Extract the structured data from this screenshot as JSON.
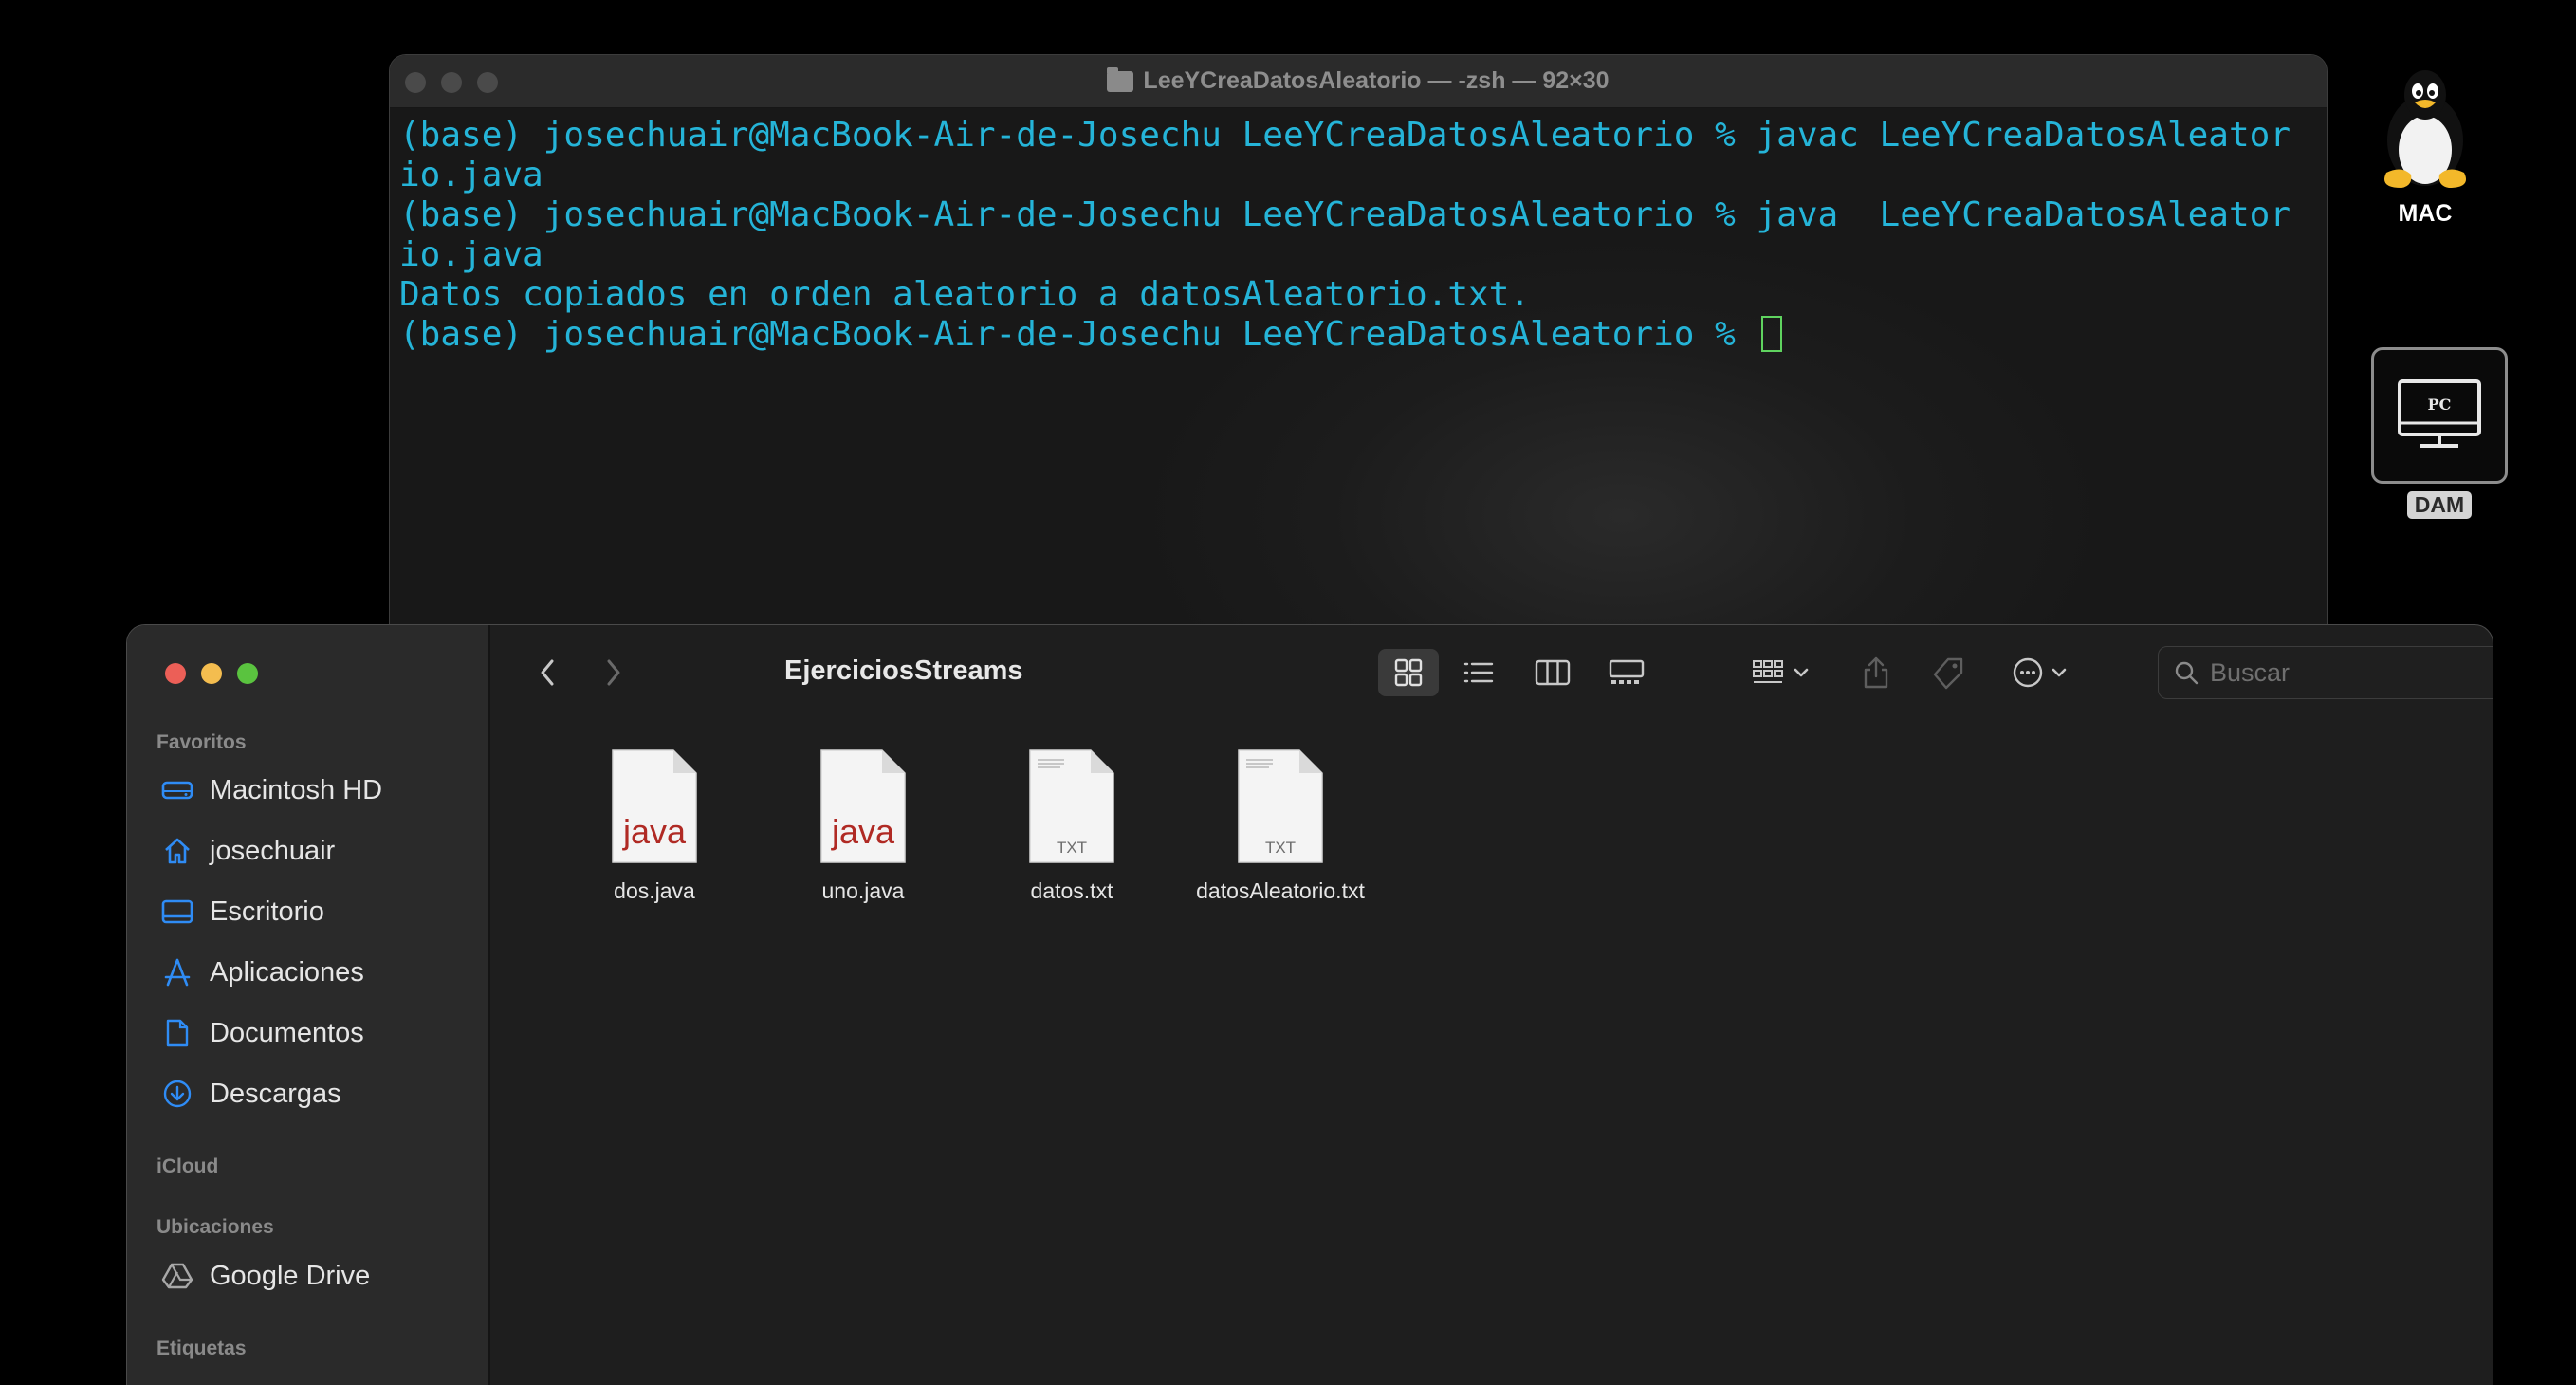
{
  "terminal": {
    "title": "LeeYCreaDatosAleatorio — -zsh — 92×30",
    "lines": [
      "(base) josechuair@MacBook-Air-de-Josechu LeeYCreaDatosAleatorio % javac LeeYCreaDatosAleator",
      "io.java",
      "(base) josechuair@MacBook-Air-de-Josechu LeeYCreaDatosAleatorio % java  LeeYCreaDatosAleator",
      "io.java",
      "Datos copiados en orden aleatorio a datosAleatorio.txt.",
      "(base) josechuair@MacBook-Air-de-Josechu LeeYCreaDatosAleatorio % "
    ]
  },
  "desktop": {
    "mac_label": "MAC",
    "pc_screen_text": "PC",
    "dam_label": "DAM"
  },
  "finder": {
    "title": "EjerciciosStreams",
    "search_placeholder": "Buscar",
    "sidebar": {
      "favorites_heading": "Favoritos",
      "favorites": [
        "Macintosh HD",
        "josechuair",
        "Escritorio",
        "Aplicaciones",
        "Documentos",
        "Descargas"
      ],
      "icloud_heading": "iCloud",
      "locations_heading": "Ubicaciones",
      "locations": [
        "Google Drive"
      ],
      "tags_heading": "Etiquetas"
    },
    "files": [
      {
        "name": "dos.java",
        "badge": "java"
      },
      {
        "name": "uno.java",
        "badge": "java"
      },
      {
        "name": "datos.txt",
        "badge": "TXT"
      },
      {
        "name": "datosAleatorio.txt",
        "badge": "TXT"
      }
    ]
  },
  "colors": {
    "terminal_text": "#25b4d8",
    "cursor": "#5fd35f",
    "accent_blue": "#2f8cf5",
    "java_red": "#b02a24",
    "traffic_red": "#ec5f57",
    "traffic_yellow": "#f4bd4f",
    "traffic_green": "#5ac33f"
  }
}
